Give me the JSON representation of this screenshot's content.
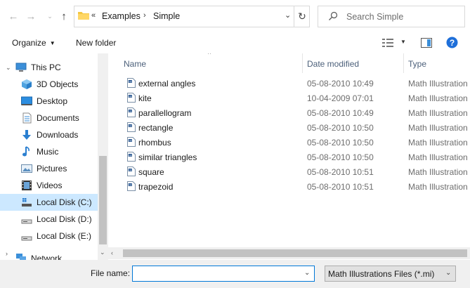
{
  "address": {
    "overflow_marker": "«",
    "crumbs": [
      "Examples",
      "Simple"
    ],
    "search_placeholder": "Search Simple"
  },
  "toolbar": {
    "organize_label": "Organize",
    "new_folder_label": "New folder"
  },
  "nav": {
    "items": [
      {
        "label": "This PC",
        "icon": "this-pc-icon"
      },
      {
        "label": "3D Objects",
        "icon": "3d-objects-icon"
      },
      {
        "label": "Desktop",
        "icon": "desktop-icon"
      },
      {
        "label": "Documents",
        "icon": "documents-icon"
      },
      {
        "label": "Downloads",
        "icon": "downloads-icon"
      },
      {
        "label": "Music",
        "icon": "music-icon"
      },
      {
        "label": "Pictures",
        "icon": "pictures-icon"
      },
      {
        "label": "Videos",
        "icon": "videos-icon"
      },
      {
        "label": "Local Disk (C:)",
        "icon": "drive-icon"
      },
      {
        "label": "Local Disk (D:)",
        "icon": "drive-icon"
      },
      {
        "label": "Local Disk (E:)",
        "icon": "drive-icon"
      },
      {
        "label": "Network",
        "icon": "network-icon"
      }
    ]
  },
  "list": {
    "columns": {
      "name": "Name",
      "date": "Date modified",
      "type": "Type"
    },
    "rows": [
      {
        "name": "external angles",
        "date": "05-08-2010 10:49",
        "type": "Math Illustration"
      },
      {
        "name": "kite",
        "date": "10-04-2009 07:01",
        "type": "Math Illustration"
      },
      {
        "name": "parallellogram",
        "date": "05-08-2010 10:49",
        "type": "Math Illustration"
      },
      {
        "name": "rectangle",
        "date": "05-08-2010 10:50",
        "type": "Math Illustration"
      },
      {
        "name": "rhombus",
        "date": "05-08-2010 10:50",
        "type": "Math Illustration"
      },
      {
        "name": "similar triangles",
        "date": "05-08-2010 10:50",
        "type": "Math Illustration"
      },
      {
        "name": "square",
        "date": "05-08-2010 10:51",
        "type": "Math Illustration"
      },
      {
        "name": "trapezoid",
        "date": "05-08-2010 10:51",
        "type": "Math Illustration"
      }
    ]
  },
  "bottom": {
    "file_name_label": "File name:",
    "file_name_value": "",
    "file_type": "Math Illustrations Files (*.mi)"
  },
  "colors": {
    "selection": "#cce8ff",
    "accent": "#0078d7",
    "help": "#1e6fd9"
  }
}
